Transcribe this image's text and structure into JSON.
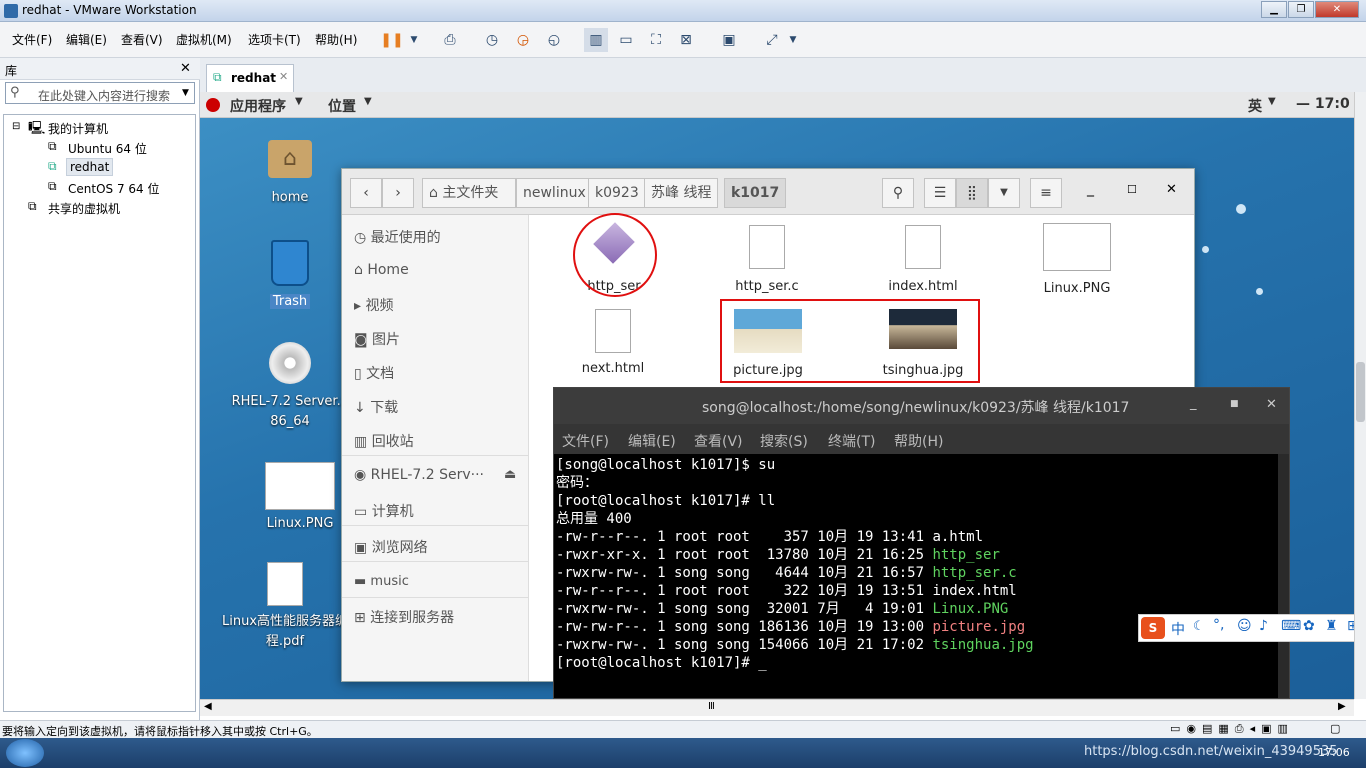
{
  "window": {
    "title": "redhat - VMware Workstation"
  },
  "menu": [
    "文件(F)",
    "编辑(E)",
    "查看(V)",
    "虚拟机(M)",
    "选项卡(T)",
    "帮助(H)"
  ],
  "library": {
    "title": "库",
    "search_placeholder": "在此处键入内容进行搜索",
    "root": "我的计算机",
    "vms": [
      "Ubuntu 64 位",
      "redhat",
      "CentOS 7 64 位"
    ],
    "shared": "共享的虚拟机"
  },
  "tab": {
    "label": "redhat"
  },
  "gnome": {
    "apps": "应用程序",
    "places": "位置",
    "ime": "英",
    "clock": "17:0"
  },
  "desktop": {
    "icons": [
      "home",
      "Trash",
      "RHEL-7.2 Server.x86_64",
      "Linux.PNG",
      "Linux高性能服务器编程.pdf"
    ]
  },
  "filemanager": {
    "crumbs": [
      "主文件夹",
      "newlinux",
      "k0923",
      "苏峰 线程",
      "k1017"
    ],
    "sidebar": [
      "最近使用的",
      "Home",
      "视频",
      "图片",
      "文档",
      "下载",
      "回收站",
      "RHEL-7.2 Serv···",
      "计算机",
      "浏览网络",
      "music",
      "连接到服务器"
    ],
    "files": [
      "http_ser",
      "http_ser.c",
      "index.html",
      "Linux.PNG",
      "next.html",
      "picture.jpg",
      "tsinghua.jpg"
    ]
  },
  "terminal": {
    "title": "song@localhost:/home/song/newlinux/k0923/苏峰 线程/k1017",
    "menu": [
      "文件(F)",
      "编辑(E)",
      "查看(V)",
      "搜索(S)",
      "终端(T)",
      "帮助(H)"
    ],
    "lines": [
      "[song@localhost k1017]$ su",
      "密码：",
      "[root@localhost k1017]# ll",
      "总用量 400",
      "-rw-r--r--. 1 root root    357 10月 19 13:41 ",
      "-rwxr-xr-x. 1 root root  13780 10月 21 16:25 ",
      "-rwxrw-rw-. 1 song song   4644 10月 21 16:57 ",
      "-rw-r--r--. 1 root root    322 10月 19 13:51 ",
      "-rwxrw-rw-. 1 song song  32001 7月   4 19:01 ",
      "-rw-rw-r--. 1 song song 186136 10月 19 13:00 ",
      "-rwxrw-rw-. 1 song song 154066 10月 21 17:02 ",
      "[root@localhost k1017]# _"
    ],
    "names": [
      "a.html",
      "http_ser",
      "http_ser.c",
      "index.html",
      "Linux.PNG",
      "picture.jpg",
      "tsinghua.jpg"
    ]
  },
  "ime": {
    "text": "中"
  },
  "status": {
    "hint": "要将输入定向到该虚拟机，请将鼠标指针移入其中或按 Ctrl+G。"
  },
  "taskbar": {
    "watermark": "https://blog.csdn.net/weixin_43949535",
    "time": "17:06"
  },
  "colors": {
    "green": "#5fd35f",
    "pink": "#f08080",
    "red": "#e01010"
  }
}
